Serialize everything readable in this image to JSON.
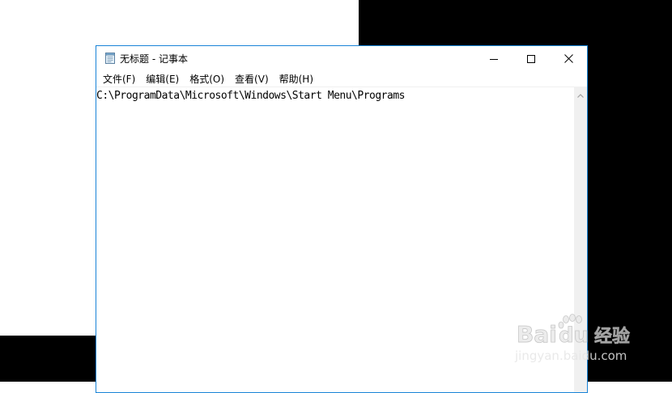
{
  "window": {
    "title": "无标题 - 记事本",
    "border_color": "#1883d7"
  },
  "menu": {
    "items": [
      "文件(F)",
      "编辑(E)",
      "格式(O)",
      "查看(V)",
      "帮助(H)"
    ]
  },
  "editor": {
    "content": "C:\\ProgramData\\Microsoft\\Windows\\Start Menu\\Programs"
  },
  "icons": {
    "app": "notepad-icon",
    "minimize": "minimize-icon",
    "maximize": "maximize-icon",
    "close": "close-icon",
    "scroll_up": "scroll-up-arrow-icon"
  },
  "watermark": {
    "logo": "Bai du 经验",
    "url": "jingyan.baidu.com"
  }
}
